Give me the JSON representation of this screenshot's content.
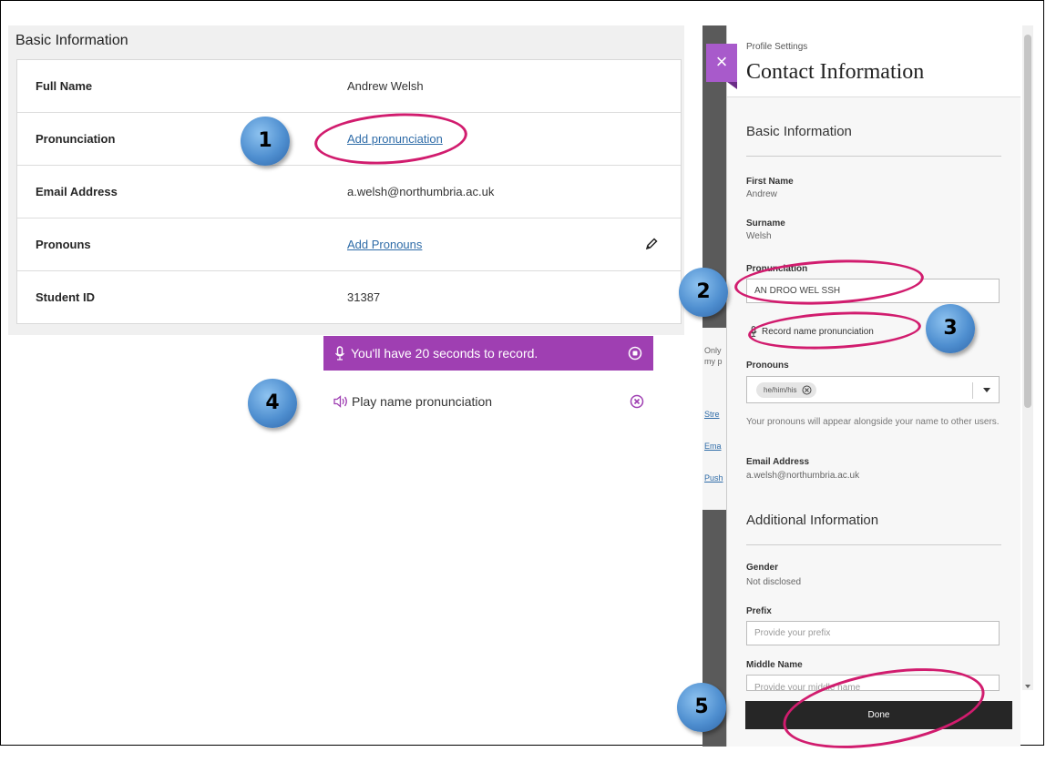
{
  "basic_info": {
    "title": "Basic Information",
    "rows": [
      {
        "label": "Full Name",
        "value": "Andrew Welsh"
      },
      {
        "label": "Pronunciation",
        "value": "Add pronunciation"
      },
      {
        "label": "Email Address",
        "value": "a.welsh@northumbria.ac.uk"
      },
      {
        "label": "Pronouns",
        "value": "Add Pronouns"
      },
      {
        "label": "Student ID",
        "value": "31387"
      }
    ]
  },
  "record_banner": {
    "text": "You'll have 20 seconds to record."
  },
  "play_row": {
    "text": "Play name pronunciation"
  },
  "background_page": {
    "text1": "Only",
    "text2": "my p",
    "link1": "Stre",
    "link2": "Ema",
    "link3": "Push"
  },
  "panel": {
    "breadcrumb": "Profile Settings",
    "title": "Contact Information",
    "close_label": "×",
    "basic_section": "Basic Information",
    "first_name_label": "First Name",
    "first_name_value": "Andrew",
    "surname_label": "Surname",
    "surname_value": "Welsh",
    "pronunciation_label": "Pronunciation",
    "pronunciation_value": "AN DROO WEL SSH",
    "record_label": "Record name pronunciation",
    "pronouns_label": "Pronouns",
    "pronoun_chip": "he/him/his",
    "pronouns_help": "Your pronouns will appear alongside your name to other users.",
    "email_label": "Email Address",
    "email_value": "a.welsh@northumbria.ac.uk",
    "additional_section": "Additional Information",
    "gender_label": "Gender",
    "gender_value": "Not disclosed",
    "prefix_label": "Prefix",
    "prefix_placeholder": "Provide your prefix",
    "middle_name_label": "Middle Name",
    "middle_name_placeholder": "Provide your middle name",
    "done_label": "Done"
  },
  "annotations": [
    "1",
    "2",
    "3",
    "4",
    "5"
  ],
  "colors": {
    "accent_purple": "#9f3fb2",
    "annotation_ring": "#d11c6e",
    "badge_blue": "#4f8fd0",
    "link_blue": "#2f6ca8"
  },
  "icons": [
    "pencil-icon",
    "microphone-icon",
    "stop-icon",
    "speaker-icon",
    "close-circle-icon",
    "close-icon",
    "chevron-down-icon"
  ]
}
